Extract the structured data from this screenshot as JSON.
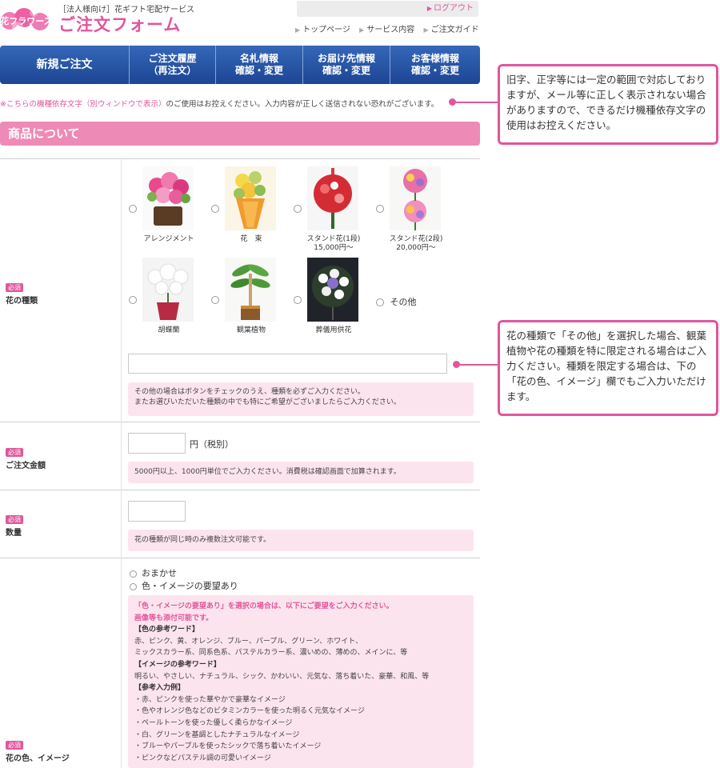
{
  "header": {
    "logo_text": "花フラワーズ",
    "tagline": "［法人様向け］花ギフト宅配サービス",
    "title": "ご注文フォーム",
    "logout": "ログアウト",
    "links": [
      "トップページ",
      "サービス内容",
      "ご注文ガイド"
    ]
  },
  "mainnav": [
    {
      "line1": "新規ご注文",
      "line2": ""
    },
    {
      "line1": "ご注文履歴",
      "line2": "（再注文）"
    },
    {
      "line1": "名札情報",
      "line2": "確認・変更"
    },
    {
      "line1": "お届け先情報",
      "line2": "確認・変更"
    },
    {
      "line1": "お客様情報",
      "line2": "確認・変更"
    }
  ],
  "notice": {
    "prefix": "※",
    "link": "こちらの機種依存文字（別ウィンドウで表示）",
    "rest": "のご使用はお控えください。入力内容が正しく送信されない恐れがございます。"
  },
  "section_title": "商品について",
  "required_badge": "必須",
  "flower_type": {
    "label": "花の種類",
    "options": [
      {
        "caption": "アレンジメント",
        "price": ""
      },
      {
        "caption": "花　束",
        "price": ""
      },
      {
        "caption": "スタンド花(1段)",
        "price": "15,000円～"
      },
      {
        "caption": "スタンド花(2段)",
        "price": "20,000円～"
      },
      {
        "caption": "胡蝶蘭",
        "price": ""
      },
      {
        "caption": "観葉植物",
        "price": ""
      },
      {
        "caption": "葬儀用供花",
        "price": ""
      }
    ],
    "other_label": "その他",
    "other_value": "",
    "help": [
      "その他の場合はボタンをチェックのうえ、種類を必ずご入力ください。",
      "またお選びいただいた種類の中でも特にご希望がございましたらご入力ください。"
    ]
  },
  "amount": {
    "label": "ご注文金額",
    "value": "",
    "unit": "円（税別）",
    "help": "5000円以上、1000円単位でご入力ください。消費税は確認画面で加算されます。"
  },
  "quantity": {
    "label": "数量",
    "value": "",
    "help": "花の種類が同じ時のみ複数注文可能です。"
  },
  "color_image": {
    "label": "花の色、イメージ",
    "options": [
      "おまかせ",
      "色・イメージの要望あり"
    ],
    "help_pink": [
      "「色・イメージの要望あり」を選択の場合は、以下にご要望をご入力ください。",
      "画像等も添付可能です。"
    ],
    "color_heading": "【色の参考ワード】",
    "color_words": [
      "赤、ピンク、黄、オレンジ、ブルー、パープル、グリーン、ホワイト、",
      "ミックスカラー系、同系色系、パステルカラー系、濃いめの、薄めの、メインに、等"
    ],
    "image_heading": "【イメージの参考ワード】",
    "image_words": "明るい、やさしい、ナチュラル、シック、かわいい、元気な、落ち着いた、豪華、和風、等",
    "example_heading": "【参考入力例】",
    "examples": [
      "・赤、ピンクを使った華やかで豪華なイメージ",
      "・色やオレンジ色などのビタミンカラーを使った明るく元気なイメージ",
      "・ペールトーンを使った優しく柔らかなイメージ",
      "・白、グリーンを基調としたナチュラルなイメージ",
      "・ブルーやパープルを使ったシックで落ち着いたイメージ",
      "・ピンクなどパステル調の可愛いイメージ"
    ]
  },
  "callouts": {
    "notice": "旧字、正字等には一定の範囲で対応しておりますが、メール等に正しく表示されない場合がありますので、できるだけ機種依存文字の使用はお控えください。",
    "other": "花の種類で「その他」を選択した場合、観葉植物や花の種類を特に限定される場合はご入力ください。種類を限定する場合は、下の「花の色、イメージ」欄でもご入力いただけます。"
  },
  "colors": {
    "accent_pink": "#e0569b",
    "nav_blue": "#1d4594",
    "section_pink": "#ee8ab6",
    "help_bg": "#fce4ee"
  }
}
